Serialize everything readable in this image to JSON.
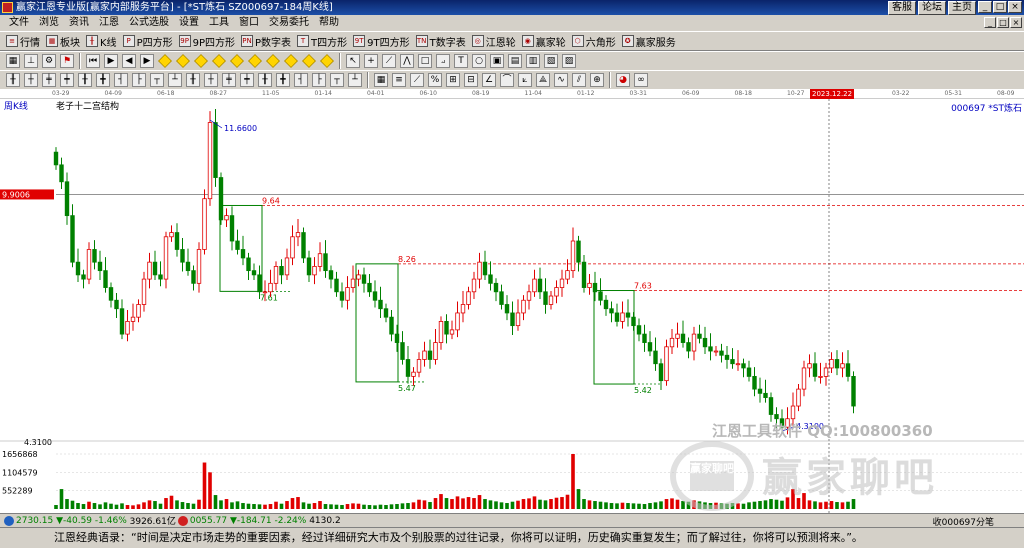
{
  "window": {
    "title": "赢家江恩专业版[赢家内部服务平台] - [*ST炼石  SZ000697-184周K线]",
    "links": [
      "客服",
      "论坛",
      "主页"
    ],
    "controls": [
      "_",
      "□",
      "×"
    ]
  },
  "menu": {
    "items": [
      "文件",
      "浏览",
      "资讯",
      "江恩",
      "公式选股",
      "设置",
      "工具",
      "窗口",
      "交易委托",
      "帮助"
    ],
    "mdi_controls": [
      "_",
      "□",
      "×"
    ]
  },
  "toolbar1": {
    "items": [
      {
        "icon": "list-icon",
        "label": "行情"
      },
      {
        "icon": "grid-icon",
        "label": "板块"
      },
      {
        "icon": "candle-icon",
        "label": "K线"
      },
      {
        "icon": "p-icon",
        "badge": "P",
        "label": "P四方形"
      },
      {
        "icon": "9p-icon",
        "badge": "9P",
        "label": "9P四方形"
      },
      {
        "icon": "pn-icon",
        "badge": "PN",
        "label": "P数字表"
      },
      {
        "icon": "t-icon",
        "badge": "T",
        "label": "T四方形"
      },
      {
        "icon": "9t-icon",
        "badge": "9T",
        "label": "9T四方形"
      },
      {
        "icon": "tn-icon",
        "badge": "TN",
        "label": "T数字表"
      },
      {
        "icon": "wheel-icon",
        "label": "江恩轮"
      },
      {
        "icon": "wheel2-icon",
        "label": "赢家轮"
      },
      {
        "icon": "hexagon-icon",
        "label": "六角形"
      },
      {
        "icon": "service-icon",
        "label": "赢家服务"
      }
    ]
  },
  "chart": {
    "period_label": "周K线",
    "indicator_name": "老子十二宫结构",
    "stock_label": "000697 *ST炼石",
    "current_price_tag": "9.9006",
    "low_axis_label": "4.3100",
    "volume_axis_labels": [
      "1656868",
      "1104579",
      "552289"
    ],
    "annotations": [
      "11.6600",
      "9.64",
      "7.61",
      "8.26",
      "5.47",
      "7.63",
      "5.42",
      "4.3100"
    ],
    "watermark": {
      "line1": "江恩工具软件  QQ:100800360",
      "seal": "赢家聊吧",
      "brand": "赢家聊吧"
    },
    "date_ticks": [
      "03-29",
      "04-09",
      "06-18",
      "08-27",
      "11-05",
      "01-14",
      "04-01",
      "06-10",
      "08-19",
      "11-04",
      "01-12",
      "03-31",
      "06-09",
      "08-18",
      "10-27",
      "2023.12.22",
      "03-22",
      "05-31",
      "08-09"
    ],
    "cursor_date": "2023.12.22",
    "colors": {
      "up": "#e00000",
      "down": "#008000",
      "box": "#008000",
      "dash_red": "#e00000",
      "dash_green": "#008000",
      "background": "#ffffff"
    }
  },
  "chart_data": {
    "type": "candlestick",
    "title": "老子十二宫结构",
    "ylim": [
      4.31,
      11.66
    ],
    "reference_levels": [
      {
        "label": "11.6600",
        "value": 11.66
      },
      {
        "label": "9.64",
        "value": 9.64
      },
      {
        "label": "8.26",
        "value": 8.26
      },
      {
        "label": "7.63",
        "value": 7.63
      },
      {
        "label": "7.61",
        "value": 7.61
      },
      {
        "label": "5.47",
        "value": 5.47
      },
      {
        "label": "5.42",
        "value": 5.42
      },
      {
        "label": "4.3100",
        "value": 4.31
      }
    ],
    "close": [
      10.6,
      10.2,
      9.4,
      8.3,
      8.0,
      7.9,
      8.6,
      8.3,
      8.1,
      7.7,
      7.4,
      7.2,
      6.6,
      6.9,
      7.0,
      7.3,
      7.9,
      8.3,
      8.0,
      7.9,
      8.9,
      9.0,
      8.6,
      8.3,
      8.1,
      7.8,
      8.6,
      9.8,
      11.6,
      10.3,
      9.3,
      9.4,
      8.8,
      8.6,
      8.4,
      8.1,
      8.0,
      7.6,
      7.6,
      7.8,
      8.2,
      8.0,
      8.4,
      8.9,
      9.0,
      8.4,
      8.0,
      8.2,
      8.5,
      8.1,
      7.9,
      7.6,
      7.4,
      7.7,
      7.9,
      8.0,
      7.8,
      7.6,
      7.4,
      7.2,
      7.0,
      6.6,
      6.4,
      6.0,
      5.6,
      5.7,
      6.0,
      6.2,
      6.0,
      6.4,
      6.9,
      6.6,
      6.7,
      7.1,
      7.3,
      7.6,
      7.9,
      8.3,
      8.0,
      7.8,
      7.6,
      7.3,
      7.1,
      6.8,
      7.1,
      7.4,
      7.6,
      7.9,
      7.6,
      7.3,
      7.5,
      7.7,
      7.9,
      8.1,
      8.8,
      8.3,
      7.7,
      7.8,
      7.6,
      7.4,
      7.2,
      7.1,
      6.9,
      7.1,
      7.0,
      6.8,
      6.6,
      6.4,
      6.2,
      5.9,
      5.5,
      6.3,
      6.5,
      6.6,
      6.4,
      6.2,
      6.6,
      6.5,
      6.3,
      6.2,
      6.2,
      6.1,
      6.0,
      5.9,
      5.9,
      5.8,
      5.6,
      5.3,
      5.2,
      5.1,
      4.7,
      4.6,
      4.4,
      4.6,
      4.9,
      5.3,
      5.8,
      5.9,
      5.6,
      5.6,
      5.8,
      6.0,
      5.8,
      5.9,
      5.6,
      4.9
    ],
    "volume": [
      120000,
      600000,
      300000,
      250000,
      180000,
      150000,
      220000,
      180000,
      140000,
      200000,
      160000,
      130000,
      170000,
      120000,
      110000,
      140000,
      200000,
      260000,
      240000,
      160000,
      330000,
      400000,
      260000,
      210000,
      180000,
      160000,
      280000,
      1400000,
      1104579,
      420000,
      260000,
      300000,
      200000,
      230000,
      180000,
      160000,
      150000,
      140000,
      130000,
      150000,
      220000,
      160000,
      240000,
      330000,
      360000,
      200000,
      160000,
      180000,
      240000,
      150000,
      140000,
      130000,
      120000,
      150000,
      170000,
      160000,
      130000,
      120000,
      110000,
      130000,
      120000,
      140000,
      150000,
      170000,
      180000,
      200000,
      280000,
      260000,
      210000,
      330000,
      450000,
      330000,
      300000,
      380000,
      320000,
      360000,
      330000,
      420000,
      300000,
      260000,
      230000,
      200000,
      180000,
      220000,
      250000,
      300000,
      320000,
      380000,
      280000,
      260000,
      300000,
      340000,
      360000,
      430000,
      1656868,
      600000,
      300000,
      260000,
      240000,
      220000,
      200000,
      180000,
      170000,
      190000,
      180000,
      170000,
      160000,
      150000,
      180000,
      200000,
      230000,
      300000,
      320000,
      280000,
      240000,
      220000,
      260000,
      230000,
      200000,
      180000,
      190000,
      170000,
      160000,
      180000,
      170000,
      160000,
      200000,
      220000,
      240000,
      260000,
      300000,
      280000,
      250000,
      350000,
      600000,
      330000,
      480000,
      260000,
      230000,
      200000,
      220000,
      240000,
      210000,
      200000,
      220000,
      300000
    ]
  },
  "statusbar": {
    "sh_index": "2730.15",
    "sh_change": "▼-40.59",
    "sh_pct": "-1.46%",
    "sh_amount": "3926.61亿",
    "sz_index": "0055.77",
    "sz_change": "▼-184.71",
    "sz_pct": "-2.24%",
    "sz_amount": "4130.2",
    "right_text": "收000697分笔"
  },
  "quote": "江恩经典语录：“时间是决定市场走势的重要因素，经过详细研究大市及个别股票的过往记录，你将可以证明，历史确实重复发生；而了解过往，你将可以预测将来。”。"
}
